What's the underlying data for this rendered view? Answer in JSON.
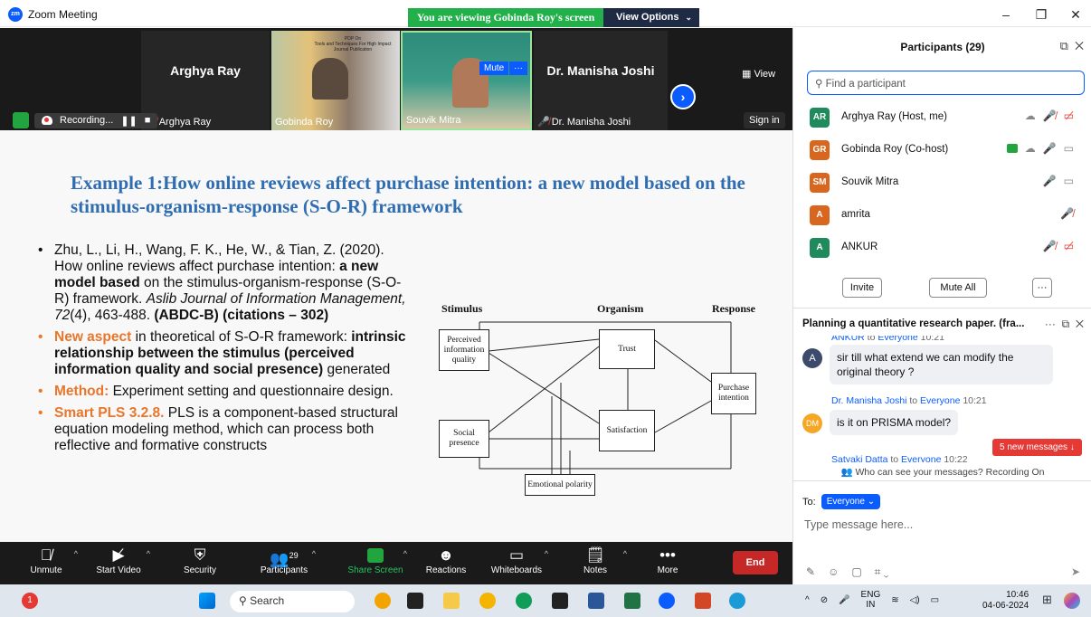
{
  "window": {
    "title": "Zoom Meeting",
    "logo": "zm"
  },
  "banner": {
    "viewing": "You are viewing Gobinda Roy's screen",
    "view_options": "View Options"
  },
  "strip": {
    "tiles": [
      {
        "name": "Arghya Ray",
        "big_name": "Arghya Ray"
      },
      {
        "name": "Gobinda Roy"
      },
      {
        "name": "Souvik Mitra"
      },
      {
        "name": "Dr. Manisha Joshi",
        "big_name": "Dr. Manisha Joshi"
      }
    ],
    "view_label": "View",
    "recording": "Recording...",
    "pause_icon": "pause-icon",
    "sign_in": "Sign in",
    "mute_chip": "Mute",
    "more_chip": "···",
    "ppt_line1": "PDP On",
    "ppt_line2": "Tools and Techniques For High Impact Journal Publication"
  },
  "slide": {
    "title": "Example 1:How online reviews affect purchase intention: a new model based on the stimulus-organism-response (S-O-R) framework",
    "b1_pre": "Zhu, L., Li, H., Wang, F. K., He, W., & Tian, Z. (2020). How online reviews affect purchase intention: ",
    "b1_bold": "a new model based",
    "b1_mid": " on the stimulus-organism-response (S-O-R) framework. ",
    "b1_journal": "Aslib Journal of Information Management",
    "b1_vol": ", 72",
    "b1_rest": "(4), 463-488. ",
    "b1_tail": "(ABDC-B) (citations – 302)",
    "b2_label": "New aspect",
    "b2_text": " in theoretical of S-O-R framework: ",
    "b2_bold": "intrinsic relationship between the stimulus (perceived information quality and social presence)",
    "b2_end": " generated",
    "b3_label": "Method:",
    "b3_text": " Experiment setting and questionnaire design.",
    "b4_label": "Smart PLS 3.2.8.",
    "b4_text": " PLS is a component-based structural equation modeling method, which can process both reflective and formative constructs"
  },
  "diagram": {
    "heads": [
      "Stimulus",
      "Organism",
      "Response"
    ],
    "boxes": [
      "Perceived information quality",
      "Trust",
      "Purchase intention",
      "Social presence",
      "Satisfaction",
      "Emotional polarity"
    ]
  },
  "toolbar": {
    "items": [
      {
        "label": "Unmute",
        "icon": "mic-muted-icon"
      },
      {
        "label": "Start Video",
        "icon": "video-off-icon"
      },
      {
        "label": "Security",
        "icon": "shield-icon"
      },
      {
        "label": "Participants",
        "icon": "participants-icon",
        "count": "29"
      },
      {
        "label": "Share Screen",
        "icon": "share-screen-icon"
      },
      {
        "label": "Reactions",
        "icon": "reactions-icon"
      },
      {
        "label": "Whiteboards",
        "icon": "whiteboard-icon"
      },
      {
        "label": "Notes",
        "icon": "notes-icon"
      },
      {
        "label": "More",
        "icon": "more-icon"
      }
    ],
    "end": "End"
  },
  "participants": {
    "title": "Participants (29)",
    "search_placeholder": "Find a participant",
    "list": [
      {
        "initials": "AR",
        "name": "Arghya Ray (Host, me)",
        "color": "#1f8a5b"
      },
      {
        "initials": "GR",
        "name": "Gobinda Roy (Co-host)",
        "color": "#d9661f"
      },
      {
        "initials": "SM",
        "name": "Souvik Mitra",
        "color": "#d9661f"
      },
      {
        "initials": "A",
        "name": "amrita",
        "color": "#d9661f"
      },
      {
        "initials": "A",
        "name": "ANKUR",
        "color": "#1f8a5b"
      }
    ],
    "invite": "Invite",
    "mute_all": "Mute All",
    "more": "···"
  },
  "chat": {
    "title": "Planning a quantitative research paper. (fra...",
    "messages": [
      {
        "sender": "ANKUR",
        "to": "Everyone",
        "time": "10:21",
        "text": "sir till what extend we can modify the original theory ?",
        "avatar": "A"
      },
      {
        "sender": "Dr. Manisha Joshi",
        "to": "Everyone",
        "time": "10:21",
        "text": "is it on PRISMA model?",
        "avatar": "DM"
      },
      {
        "sender": "Satyaki Datta",
        "to": "Everyone",
        "time": "10:22"
      }
    ],
    "to_word": " to ",
    "new_messages": "5 new messages ↓",
    "who_can_see": "Who can see your messages? Recording On",
    "to_label": "To:",
    "to_value": "Everyone",
    "placeholder": "Type message here..."
  },
  "taskbar": {
    "search": "Search",
    "lang1": "ENG",
    "lang2": "IN",
    "time": "10:46",
    "date": "04-06-2024",
    "notif_badge": "1"
  }
}
